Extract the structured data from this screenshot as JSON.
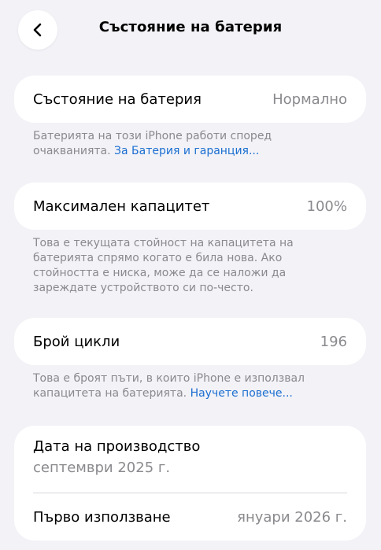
{
  "nav": {
    "title": "Състояние на батерия"
  },
  "battery_health": {
    "label": "Състояние на батерия",
    "value": "Нормално",
    "note": "Батерията на този iPhone работи според очакванията. ",
    "link": "За Батерия и гаранция..."
  },
  "max_capacity": {
    "label": "Максимален капацитет",
    "value": "100%",
    "note": "Това е текущата стойност на капацитета на батерията спрямо когато е била нова. Ако стойността е ниска, може да се наложи да зареждате устройството си по-често."
  },
  "cycle_count": {
    "label": "Брой цикли",
    "value": "196",
    "note": "Това е броят пъти, в които iPhone е използвал капацитета на батерията. ",
    "link": "Научете повече..."
  },
  "dates": {
    "manufacture_label": "Дата на производство",
    "manufacture_value": "септември 2025 г.",
    "first_use_label": "Първо използване",
    "first_use_value": "януари 2026 г."
  }
}
